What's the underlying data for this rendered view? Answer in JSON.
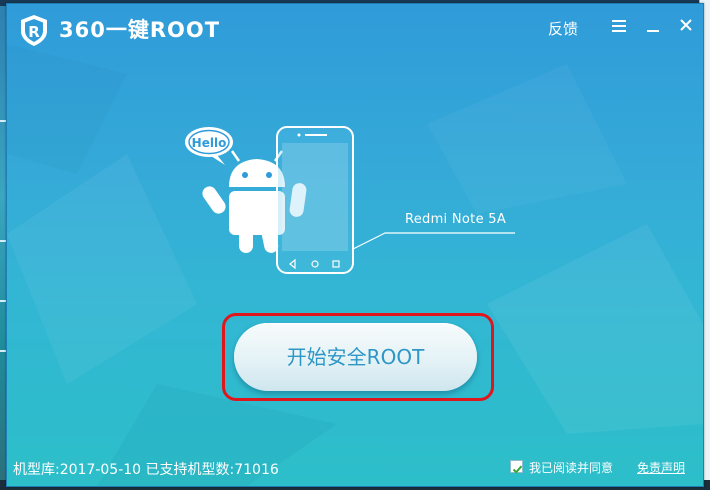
{
  "window": {
    "title": "360一键ROOT",
    "feedback_label": "反馈"
  },
  "illustration": {
    "bubble_text": "Hello",
    "device_name": "Redmi Note 5A"
  },
  "main": {
    "start_button_label": "开始安全ROOT"
  },
  "footer": {
    "db_info": "机型库:2017-05-10 已支持机型数:71016",
    "agree_label": "我已阅读并同意",
    "agree_checked": true,
    "disclaimer_label": "免责声明"
  },
  "colors": {
    "accent": "#33a7d6",
    "highlight": "#e0161d",
    "check": "#3aa838"
  }
}
